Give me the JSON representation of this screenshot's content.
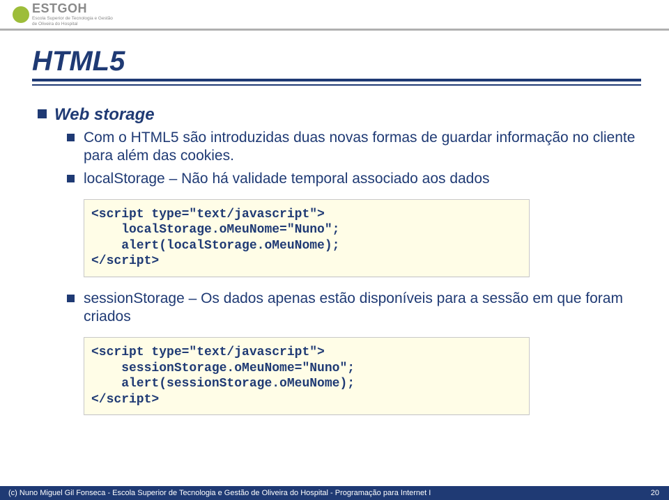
{
  "header": {
    "logo_main": "ESTGOH",
    "logo_sub_line1": "Escola Superior de Tecnologia e Gestão",
    "logo_sub_line2": "de Oliveira do Hospital"
  },
  "title": "HTML5",
  "bullets": {
    "l1_text": "Web storage",
    "l2a_text": "Com o HTML5 são introduzidas duas novas formas de guardar informação no cliente para além das cookies.",
    "l2b_text": "localStorage – Não há validade temporal associado aos dados",
    "l2c_text": "sessionStorage – Os dados apenas estão disponíveis para a sessão em que foram criados"
  },
  "code": {
    "block1": "<script type=\"text/javascript\">\n    localStorage.oMeuNome=\"Nuno\";\n    alert(localStorage.oMeuNome);\n</script>",
    "block2": "<script type=\"text/javascript\">\n    sessionStorage.oMeuNome=\"Nuno\";\n    alert(sessionStorage.oMeuNome);\n</script>"
  },
  "footer": {
    "left": "(c) Nuno Miguel Gil Fonseca  -  Escola Superior de Tecnologia e Gestão de Oliveira do Hospital  -  Programação para Internet I",
    "page": "20"
  }
}
